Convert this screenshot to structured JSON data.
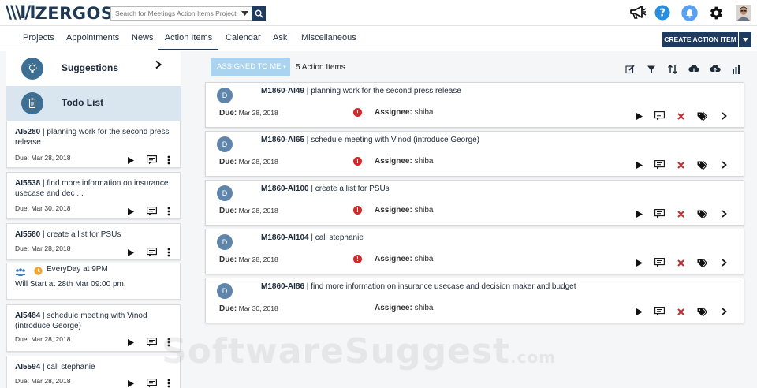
{
  "header": {
    "logo_mark": "\\\\\\I/I",
    "logo_word": "ZERGOS",
    "search": {
      "placeholder": "Search for Meetings Action Items Projects"
    }
  },
  "nav": {
    "items": [
      {
        "label": "Projects"
      },
      {
        "label": "Appointments"
      },
      {
        "label": "News"
      },
      {
        "label": "Action Items",
        "active": true
      },
      {
        "label": "Calendar"
      },
      {
        "label": "Ask"
      },
      {
        "label": "Miscellaneous"
      }
    ],
    "create_label": "CREATE ACTION ITEM"
  },
  "sidebar": {
    "suggestions_title": "Suggestions",
    "todo_title": "Todo List",
    "cards": [
      {
        "id": "AI5280",
        "text": "planning work for the second press release",
        "due_label": "Due:",
        "due": "Mar 28, 2018"
      },
      {
        "id": "AI5538",
        "text": "find more information on insurance usecase and dec ...",
        "due_label": "Due:",
        "due": "Mar 30, 2018"
      },
      {
        "id": "AI5580",
        "text": "create a list for PSUs",
        "due_label": "Due:",
        "due": "Mar 28, 2018"
      },
      {
        "recurring": "EveryDay at 9PM",
        "starts": "Will Start at 28th Mar 09:00 pm."
      },
      {
        "id": "AI5484",
        "text": "schedule meeting with Vinod (introduce George)",
        "due_label": "Due:",
        "due": "Mar 28, 2018"
      },
      {
        "id": "AI5594",
        "text": "call stephanie",
        "due_label": "Due:",
        "due": "Mar 28, 2018"
      }
    ]
  },
  "toolbar": {
    "assigned_label": "ASSIGNED TO ME",
    "count_label": "5 Action Items"
  },
  "items": [
    {
      "avatar": "D",
      "code": "M1860-AI49",
      "title": "planning work for the second press release",
      "due_label": "Due:",
      "due": "Mar 28, 2018",
      "warn": "!",
      "assignee_label": "Assignee:",
      "assignee": "shiba"
    },
    {
      "avatar": "D",
      "code": "M1860-AI65",
      "title": "schedule meeting with Vinod (introduce George)",
      "due_label": "Due:",
      "due": "Mar 28, 2018",
      "warn": "!",
      "assignee_label": "Assignee:",
      "assignee": "shiba"
    },
    {
      "avatar": "D",
      "code": "M1860-AI100",
      "title": "create a list for PSUs",
      "due_label": "Due:",
      "due": "Mar 28, 2018",
      "warn": "!",
      "assignee_label": "Assignee:",
      "assignee": "shiba"
    },
    {
      "avatar": "D",
      "code": "M1860-AI104",
      "title": "call stephanie",
      "due_label": "Due:",
      "due": "Mar 28, 2018",
      "warn": "!",
      "assignee_label": "Assignee:",
      "assignee": "shiba"
    },
    {
      "avatar": "D",
      "code": "M1860-AI86",
      "title": "find more information on insurance usecase and decision maker and budget",
      "due_label": "Due:",
      "due": "Mar 30, 2018",
      "warn": "!",
      "assignee_label": "Assignee:",
      "assignee": "shiba"
    }
  ],
  "watermark": {
    "main": "SoftwareSuggest",
    "suffix": ".com"
  },
  "colors": {
    "brand": "#1e3a5f",
    "accent_light": "#a9d3ef",
    "danger": "#d0282c",
    "avatar": "#5f86aa",
    "selected_panel": "#d9e5ef"
  },
  "icons": [
    "search-icon",
    "megaphone-icon",
    "help-icon",
    "notification-icon",
    "gear-icon",
    "avatar",
    "lightbulb-icon",
    "clipboard-icon",
    "play-icon",
    "comment-icon",
    "more-icon",
    "team-icon",
    "clock-icon",
    "edit-icon",
    "filter-icon",
    "sort-icon",
    "cloud-download-icon",
    "cloud-upload-icon",
    "bar-chart-icon",
    "close-icon",
    "tag-icon",
    "chevron-right-icon"
  ]
}
